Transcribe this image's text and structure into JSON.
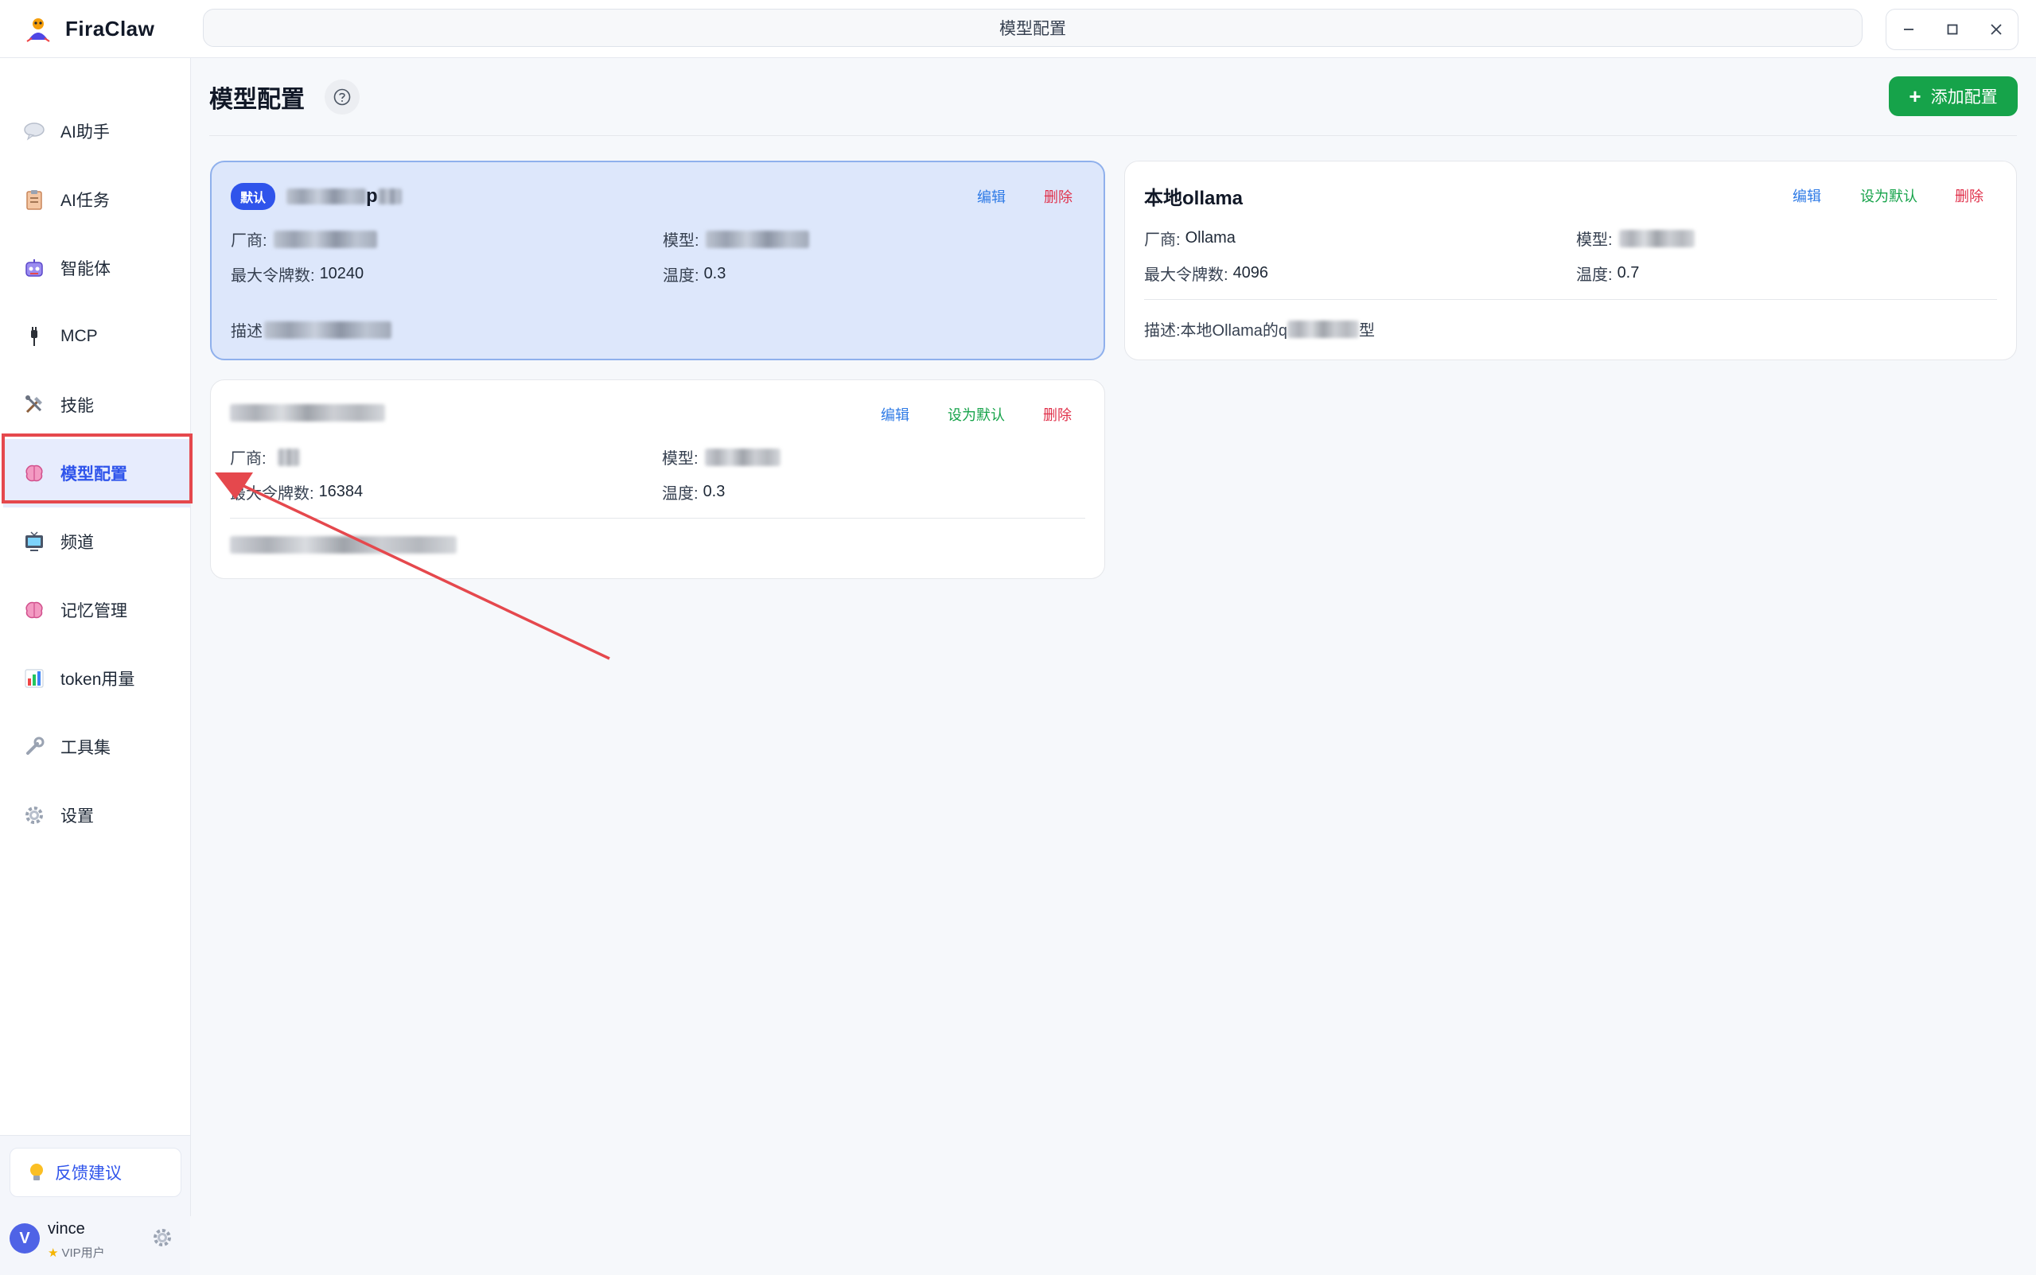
{
  "app": {
    "name": "FiraClaw",
    "window_title": "模型配置"
  },
  "sidebar": {
    "items": [
      {
        "label": "AI助手",
        "icon": "chat-bubble-icon"
      },
      {
        "label": "AI任务",
        "icon": "clipboard-icon"
      },
      {
        "label": "智能体",
        "icon": "robot-icon"
      },
      {
        "label": "MCP",
        "icon": "plug-icon"
      },
      {
        "label": "技能",
        "icon": "tools-icon"
      },
      {
        "label": "模型配置",
        "icon": "brain-icon",
        "active": true
      },
      {
        "label": "频道",
        "icon": "tv-icon"
      },
      {
        "label": "记忆管理",
        "icon": "brain-icon"
      },
      {
        "label": "token用量",
        "icon": "bar-chart-icon"
      },
      {
        "label": "工具集",
        "icon": "wrench-icon"
      },
      {
        "label": "设置",
        "icon": "gear-icon"
      }
    ],
    "feedback_label": "反馈建议",
    "user": {
      "avatar_letter": "V",
      "name": "vince",
      "tier": "VIP用户"
    }
  },
  "main": {
    "title": "模型配置",
    "add_button_label": "添加配置",
    "labels": {
      "vendor": "厂商:",
      "model": "模型:",
      "max_tokens": "最大令牌数:",
      "temperature": "温度:",
      "description": "描述:",
      "edit": "编辑",
      "set_default": "设为默认",
      "delete": "删除",
      "default_badge": "默认"
    },
    "cards": [
      {
        "name_visible_end": "p",
        "is_default": true,
        "vendor": "",
        "model": "",
        "max_tokens": "10240",
        "temperature": "0.3",
        "description_prefix": "描述"
      },
      {
        "name": "本地ollama",
        "is_default": false,
        "vendor": "Ollama",
        "model": "",
        "max_tokens": "4096",
        "temperature": "0.7",
        "description_prefix": "描述:本地Ollama的q",
        "description_suffix": "型"
      },
      {
        "name": "",
        "is_default": false,
        "vendor": "",
        "model": "",
        "max_tokens": "16384",
        "temperature": "0.3",
        "description_prefix": ""
      }
    ]
  },
  "colors": {
    "accent": "#2f54eb",
    "add_button": "#16a34a",
    "delete": "#e0314b",
    "set_default": "#16a34a",
    "edit": "#2f7be6",
    "annotation_red": "#e5484d",
    "default_card_bg": "#dde7fb"
  }
}
